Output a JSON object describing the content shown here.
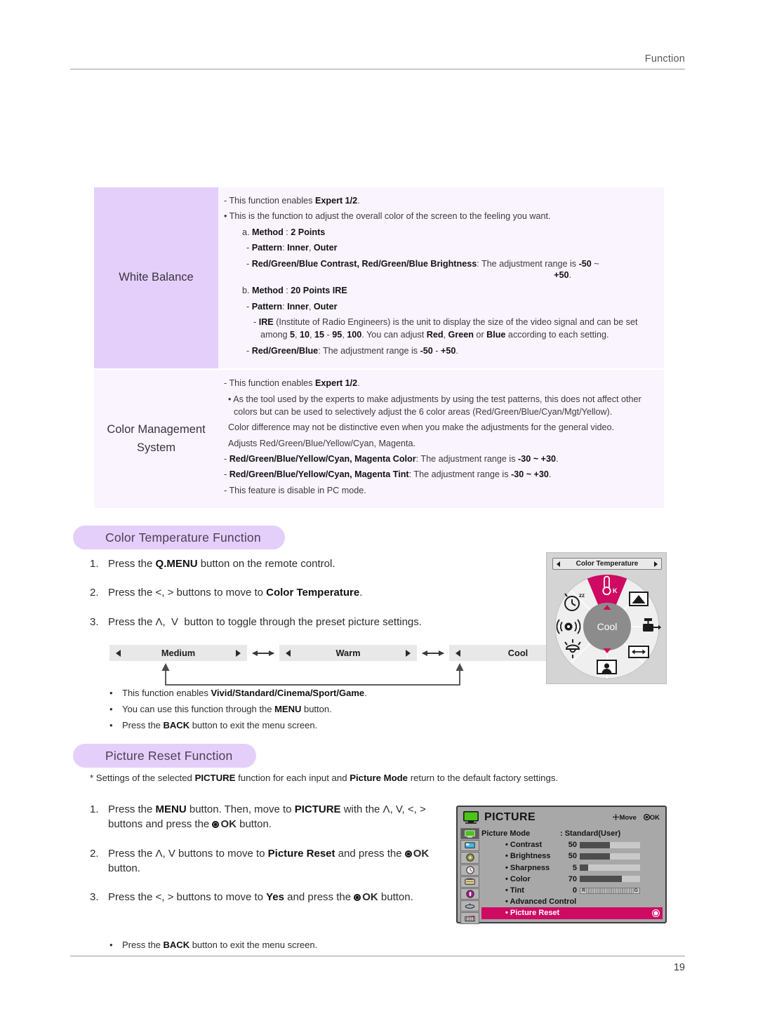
{
  "header": {
    "running_head": "Function"
  },
  "footer": {
    "page_number": "19"
  },
  "colors": {
    "accent_lavender": "#E4CFFA",
    "panel_tint": "#FAF4FE",
    "osd_highlight": "#CF0A63",
    "wheel_selected": "#CF0A63"
  },
  "feature_table": {
    "rows": [
      {
        "name": "White Balance",
        "lines": [
          {
            "text": "- This function enables Expert 1/2.",
            "indent": "dash",
            "bold": [
              "Expert 1/2"
            ]
          },
          {
            "text": "• This is the function to adjust the overall color of the screen to the feeling you want.",
            "indent": "bul",
            "bold": []
          },
          {
            "text": "a. Method : 2 Points",
            "indent": "lv1",
            "bold": [
              "Method",
              "2 Points"
            ]
          },
          {
            "text": "- Pattern: Inner, Outer",
            "indent": "lv2",
            "bold": [
              "Pattern",
              "Inner",
              "Outer"
            ]
          },
          {
            "text": "- Red/Green/Blue Contrast, Red/Green/Blue Brightness: The adjustment range is -50 ~",
            "indent": "lv2",
            "bold": [
              "Red/Green/Blue Contrast, Red/Green/Blue Brightness",
              "-50"
            ]
          },
          {
            "text": "+50.",
            "indent": "rt",
            "bold": [
              "+50"
            ]
          },
          {
            "text": "b. Method : 20 Points IRE",
            "indent": "lv1",
            "bold": [
              "Method",
              "20 Points IRE"
            ]
          },
          {
            "text": "- Pattern: Inner, Outer",
            "indent": "lv2",
            "bold": [
              "Pattern",
              "Inner",
              "Outer"
            ]
          },
          {
            "text": "- IRE (Institute of Radio Engineers) is the unit to display the size of the video signal and can be set among 5, 10, 15 - 95, 100. You can adjust Red, Green or Blue according to each setting.",
            "indent": "hang",
            "bold": [
              "IRE",
              "5",
              "10",
              "15",
              "95",
              "100",
              "Red",
              "Green",
              "Blue"
            ]
          },
          {
            "text": "- Red/Green/Blue: The adjustment range is -50 - +50.",
            "indent": "lv2",
            "bold": [
              "Red/Green/Blue",
              "-50",
              "+50"
            ]
          }
        ]
      },
      {
        "name": "Color Management\nSystem",
        "lines": [
          {
            "text": "- This function enables Expert 1/2.",
            "indent": "dash",
            "bold": [
              "Expert 1/2"
            ]
          },
          {
            "text": "• As the tool used by the experts to make adjustments by using the test patterns, this does not affect other colors but can be used to selectively adjust the 6 color areas (Red/Green/Blue/Cyan/Mgt/Yellow).",
            "indent": "bul",
            "bold": []
          },
          {
            "text": "Color difference may not be distinctive even when you make the adjustments for the general video.",
            "indent": "ind",
            "bold": []
          },
          {
            "text": "Adjusts Red/Green/Blue/Yellow/Cyan, Magenta.",
            "indent": "ind",
            "bold": []
          },
          {
            "text": "- Red/Green/Blue/Yellow/Cyan, Magenta Color: The adjustment range is -30 ~ +30.",
            "indent": "dash",
            "bold": [
              "Red/Green/Blue/Yellow/Cyan, Magenta Color",
              "-30 ~ +30"
            ]
          },
          {
            "text": "- Red/Green/Blue/Yellow/Cyan, Magenta Tint: The adjustment range is -30 ~ +30.",
            "indent": "dash",
            "bold": [
              "Red/Green/Blue/Yellow/Cyan, Magenta Tint",
              "-30 ~ +30"
            ]
          },
          {
            "text": "- This feature is disable in PC mode.",
            "indent": "dash",
            "bold": []
          }
        ]
      }
    ]
  },
  "color_temperature_section": {
    "title": "Color Temperature Function",
    "steps": [
      {
        "num": "1.",
        "text": "Press the Q.MENU button on the remote control."
      },
      {
        "num": "2.",
        "text": "Press the <, > buttons to move to Color Temperature."
      },
      {
        "num": "3.",
        "text": "Press the Λ,  V  button to toggle through the preset picture settings."
      }
    ],
    "presets": [
      "Medium",
      "Warm",
      "Cool"
    ],
    "notes": [
      "This function enables Vivid/Standard/Cinema/Sport/Game.",
      "You can use this function through the MENU button.",
      "Press the BACK button to exit the menu screen."
    ]
  },
  "qmenu_wheel": {
    "title": "Color Temperature",
    "center_label": "Cool",
    "selected_slice": "color-temperature",
    "slices": [
      {
        "name": "color-temperature",
        "icon": "thermometer-k-icon",
        "selected": true
      },
      {
        "name": "aspect-ratio",
        "icon": "aspect-ratio-icon",
        "selected": false
      },
      {
        "name": "usb-device",
        "icon": "usb-eject-icon",
        "selected": false
      },
      {
        "name": "screen-size",
        "icon": "horizontal-arrows-icon",
        "selected": false
      },
      {
        "name": "picture-mode",
        "icon": "person-portrait-icon",
        "selected": false
      },
      {
        "name": "energy-saving",
        "icon": "lamp-icon",
        "selected": false
      },
      {
        "name": "sound-mode",
        "icon": "speaker-waves-icon",
        "selected": false
      },
      {
        "name": "sleep-timer",
        "icon": "clock-zzz-icon",
        "selected": false
      }
    ]
  },
  "picture_reset_section": {
    "title": "Picture Reset Function",
    "intro": "* Settings of the selected PICTURE function for each input and Picture Mode return to the default factory settings.",
    "steps": [
      {
        "num": "1.",
        "text": "Press the MENU button. Then, move to PICTURE with the Λ, V, <, >  buttons and press the OK button."
      },
      {
        "num": "2.",
        "text": "Press the Λ, V buttons to move to Picture Reset and press the OK button."
      },
      {
        "num": "3.",
        "text": "Press the <, > buttons to move to Yes and press the OK button."
      }
    ],
    "notes": [
      "Press the BACK button to exit the menu screen."
    ]
  },
  "picture_osd": {
    "title": "PICTURE",
    "hints": [
      {
        "icon": "move-dpad-icon",
        "label": "Move"
      },
      {
        "icon": "ok-dot-icon",
        "label": "OK"
      }
    ],
    "rail_icons": [
      "picture-monitor-icon",
      "screen-blue-icon",
      "audio-disc-icon",
      "time-clock-icon",
      "lock-option-icon",
      "usb-magenta-icon",
      "network-icon",
      "film-clapper-icon"
    ],
    "rows": [
      {
        "name": "Picture Mode",
        "value": ": Standard(User)",
        "type": "text",
        "indent": false
      },
      {
        "name": "• Contrast",
        "value": "50",
        "type": "bar",
        "fill_pct": 50,
        "indent": true
      },
      {
        "name": "• Brightness",
        "value": "50",
        "type": "bar",
        "fill_pct": 50,
        "indent": true
      },
      {
        "name": "• Sharpness",
        "value": "5",
        "type": "bar",
        "fill_pct": 14,
        "indent": true
      },
      {
        "name": "• Color",
        "value": "70",
        "type": "bar",
        "fill_pct": 70,
        "indent": true
      },
      {
        "name": "• Tint",
        "value": "0",
        "type": "tint",
        "tint_left": "R",
        "tint_right": "G",
        "indent": true
      },
      {
        "name": "• Advanced Control",
        "value": "",
        "type": "text",
        "indent": true
      },
      {
        "name": "• Picture Reset",
        "value": "",
        "type": "selected",
        "indent": true
      }
    ]
  }
}
